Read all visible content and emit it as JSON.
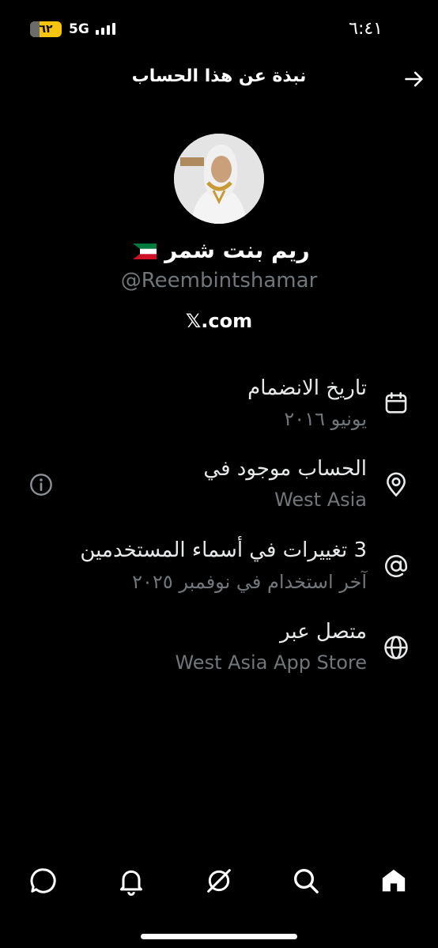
{
  "status_bar": {
    "time": "٦:٤١",
    "battery": "٦٢",
    "network": "5G"
  },
  "header": {
    "title": "نبذة عن هذا الحساب"
  },
  "profile": {
    "name": "ريم بنت شمر",
    "handle": "@Reembintshamar",
    "site": "𝕏.com"
  },
  "rows": [
    {
      "icon": "calendar-icon",
      "title": "تاريخ الانضمام",
      "value": "يونيو ٢٠١٦"
    },
    {
      "icon": "location-pin-icon",
      "title": "الحساب موجود في",
      "value": "West Asia"
    },
    {
      "icon": "at-sign-icon",
      "title": "3 تغييرات في أسماء المستخدمين",
      "value": "آخر استخدام في نوفمبر ٢٠٢٥"
    },
    {
      "icon": "globe-icon",
      "title": "متصل عبر",
      "value": "West Asia App Store"
    }
  ],
  "nav": [
    "messages-icon",
    "notifications-icon",
    "grok-icon",
    "search-icon",
    "home-icon"
  ],
  "colors": {
    "background": "#000000",
    "text": "#e7e9ea",
    "secondary": "#71767b",
    "battery": "#f7c40e"
  }
}
